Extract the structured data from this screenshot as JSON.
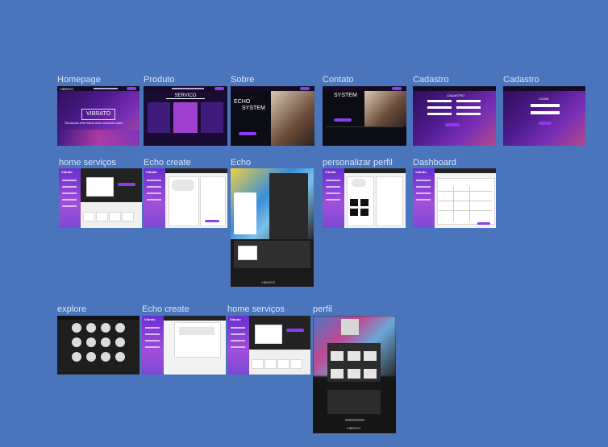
{
  "canvas": {
    "background": "#4a75bd",
    "label_color": "#dde6f5"
  },
  "frames": [
    {
      "label": "Homepage"
    },
    {
      "label": "Produto"
    },
    {
      "label": "Sobre"
    },
    {
      "label": "Contato"
    },
    {
      "label": "Cadastro"
    },
    {
      "label": "Cadastro"
    },
    {
      "label": "home serviços"
    },
    {
      "label": "Echo create"
    },
    {
      "label": "Echo"
    },
    {
      "label": "personalizar perfil"
    },
    {
      "label": "Dashboard"
    },
    {
      "label": "explore"
    },
    {
      "label": "Echo create"
    },
    {
      "label": "home serviços"
    },
    {
      "label": "perfil"
    }
  ],
  "thumb_text": {
    "homepage_logo": "VIBRATO",
    "homepage_tagline": "The sounds of the future come around the world.",
    "produto_title": "SERVICO",
    "sobre_title_1": "ECHO",
    "sobre_title_2": "SYSTEM",
    "contato_title": "SYSTEM",
    "cadastro_title": "CADASTRO",
    "login_title": "LOGIN",
    "brand_small": "VIBRATO",
    "vibrato_side": "Vibrato",
    "echo_label": "VIBRATO"
  },
  "colors": {
    "accent": "#8a3cf0",
    "dark": "#1e1e1e"
  }
}
